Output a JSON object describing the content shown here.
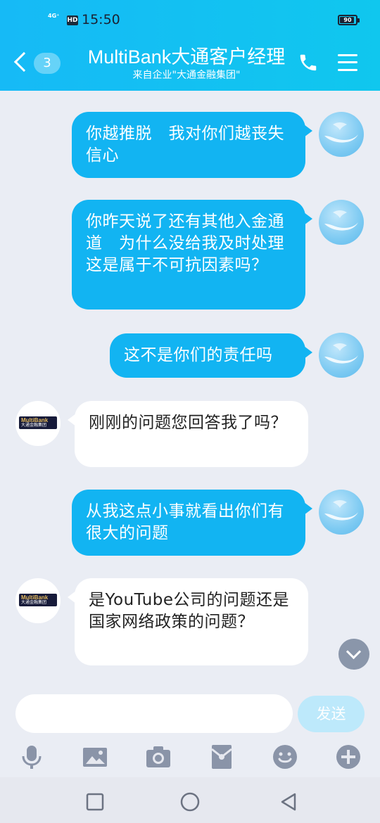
{
  "status_bar": {
    "network": "4G⁺",
    "hd": "HD",
    "time": "15:50",
    "battery": "90",
    "battery_level": 0.9
  },
  "header": {
    "back_count": "3",
    "title": "MultiBank大通客户经理",
    "subtitle": "来自企业\"大通金融集团\""
  },
  "messages": [
    {
      "side": "out",
      "text": "你越推脱　我对你们越丧失信心"
    },
    {
      "side": "out",
      "text": "你昨天说了还有其他入金通道　为什么没给我及时处理　这是属于不可抗因素吗？"
    },
    {
      "side": "out",
      "text": "这不是你们的责任吗"
    },
    {
      "side": "in",
      "text": "刚刚的问题您回答我了吗？"
    },
    {
      "side": "out",
      "text": "从我这点小事就看出你们有很大的问题"
    },
    {
      "side": "in",
      "text": "是YouTube公司的问题还是国家网络政策的问题？"
    }
  ],
  "bank_avatar": {
    "logo_line1": "MultiBank",
    "logo_line2": "大通金融集团"
  },
  "composer": {
    "placeholder": "",
    "send_label": "发送"
  },
  "toolbar": {
    "icons": [
      "microphone-icon",
      "image-icon",
      "camera-icon",
      "red-packet-icon",
      "emoji-icon",
      "plus-icon"
    ]
  },
  "colors": {
    "header_blue": "#16baf6",
    "outgoing_bubble": "#12b4f2",
    "incoming_bubble": "#ffffff",
    "chat_background": "#eaedf4"
  }
}
